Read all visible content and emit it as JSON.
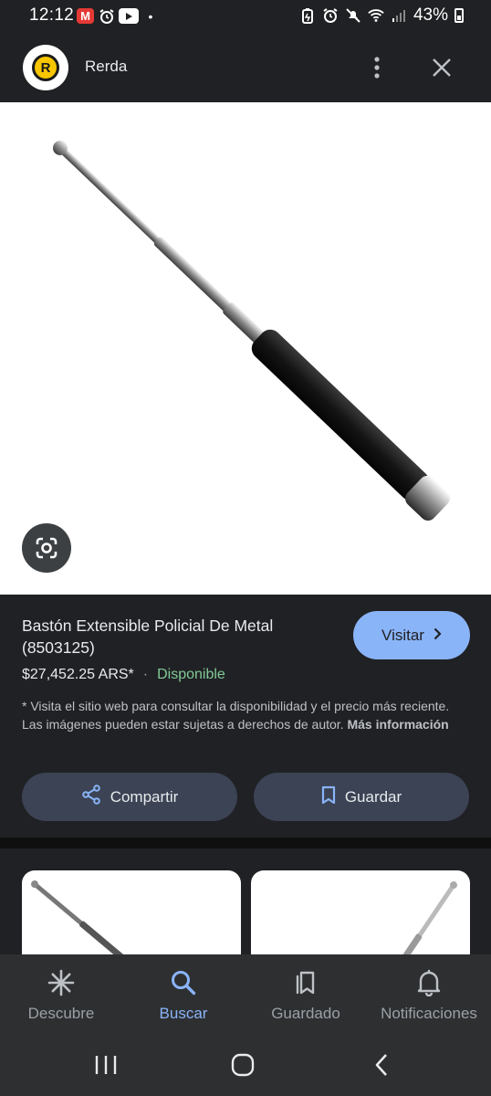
{
  "status_bar": {
    "time": "12:12",
    "notification_badge": "M",
    "battery": "43%",
    "icons": [
      "m-app-icon",
      "alarm-icon",
      "youtube-icon",
      "dot-icon",
      "battery-saver-icon",
      "alarm-icon",
      "mute-icon",
      "wifi-icon",
      "signal-icon",
      "battery-icon"
    ]
  },
  "header": {
    "logo_letter": "R",
    "site_name": "Rerda",
    "more_icon": "more-vert-icon",
    "close_icon": "close-icon"
  },
  "product": {
    "title": "Bastón Extensible Policial De Metal (8503125)",
    "visit_label": "Visitar",
    "price": "$27,452.25 ARS*",
    "separator": "·",
    "availability": "Disponible",
    "disclaimer": "* Visita el sitio web para consultar la disponibilidad y el precio más reciente. Las imágenes pueden estar sujetas a derechos de autor.",
    "more_info": "Más información",
    "share_label": "Compartir",
    "save_label": "Guardar",
    "lens_icon": "google-lens-icon"
  },
  "bottom_nav": {
    "items": [
      {
        "label": "Descubre",
        "icon": "asterisk-icon",
        "active": false
      },
      {
        "label": "Buscar",
        "icon": "search-icon",
        "active": true
      },
      {
        "label": "Guardado",
        "icon": "collections-icon",
        "active": false
      },
      {
        "label": "Notificaciones",
        "icon": "bell-icon",
        "active": false
      }
    ]
  },
  "system_nav": [
    "recents-icon",
    "home-icon",
    "back-icon"
  ],
  "colors": {
    "background": "#202124",
    "accent": "#8ab4f8",
    "availability": "#81c995",
    "button": "#3b4354"
  }
}
